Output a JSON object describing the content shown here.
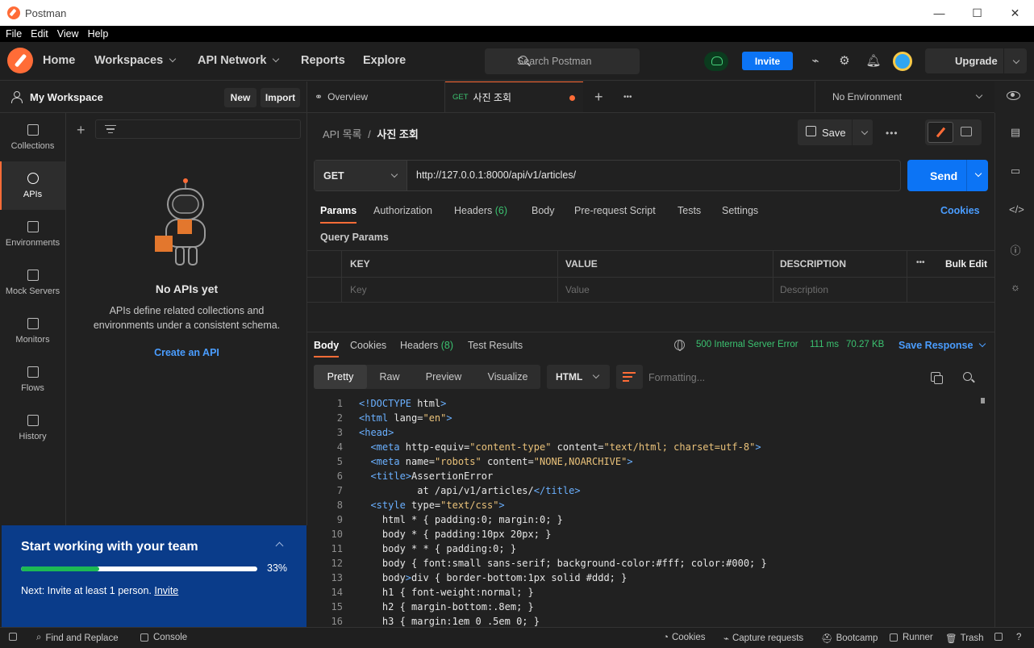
{
  "window": {
    "title": "Postman",
    "minimize_glyph": "—",
    "maximize_glyph": "☐",
    "close_glyph": "✕"
  },
  "menu": [
    "File",
    "Edit",
    "View",
    "Help"
  ],
  "nav": {
    "home": "Home",
    "workspaces": "Workspaces",
    "api_network": "API Network",
    "reports": "Reports",
    "explore": "Explore",
    "search_placeholder": "Search Postman",
    "invite": "Invite",
    "upgrade": "Upgrade"
  },
  "workspace": {
    "title": "My Workspace",
    "new_label": "New",
    "import_label": "Import"
  },
  "rail": [
    {
      "label": "Collections",
      "icon": "collections-icon"
    },
    {
      "label": "APIs",
      "icon": "apis-icon"
    },
    {
      "label": "Environments",
      "icon": "environments-icon"
    },
    {
      "label": "Mock Servers",
      "icon": "mock-servers-icon"
    },
    {
      "label": "Monitors",
      "icon": "monitors-icon"
    },
    {
      "label": "Flows",
      "icon": "flows-icon"
    },
    {
      "label": "History",
      "icon": "history-icon"
    }
  ],
  "rail_active": "APIs",
  "empty": {
    "title": "No APIs yet",
    "desc_line1": "APIs define related collections and",
    "desc_line2": "environments under a consistent schema.",
    "link": "Create an API"
  },
  "team": {
    "title": "Start working with your team",
    "progress": 0.33,
    "percent": "33%",
    "next": "Next: Invite at least 1 person.",
    "next_link": "Invite"
  },
  "tabs": {
    "overview": "Overview",
    "active_method": "GET",
    "active_name": "사진 조회",
    "add": "+",
    "more": "•••",
    "environment": "No Environment"
  },
  "request": {
    "breadcrumb_parent": "API 목록",
    "breadcrumb_sep": "/",
    "breadcrumb_current": "사진 조회",
    "save": "Save",
    "method": "GET",
    "url": "http://127.0.0.1:8000/api/v1/articles/",
    "send": "Send",
    "tabs": [
      "Params",
      "Authorization",
      "Headers",
      "Body",
      "Pre-request Script",
      "Tests",
      "Settings"
    ],
    "headers_count": "(6)",
    "cookies": "Cookies",
    "query_params": "Query Params",
    "columns": [
      "KEY",
      "VALUE",
      "DESCRIPTION"
    ],
    "bulk_edit": "Bulk Edit",
    "placeholders": [
      "Key",
      "Value",
      "Description"
    ]
  },
  "response": {
    "tabs": [
      "Body",
      "Cookies",
      "Headers",
      "Test Results"
    ],
    "headers_count": "(8)",
    "status": "500 Internal Server Error",
    "time": "111 ms",
    "size": "70.27 KB",
    "save_response": "Save Response",
    "views": [
      "Pretty",
      "Raw",
      "Preview",
      "Visualize"
    ],
    "format": "HTML",
    "formatting": "Formatting..."
  },
  "code_lines": [
    "<!DOCTYPE html>",
    "<html lang=\"en\">",
    "<head>",
    "  <meta http-equiv=\"content-type\" content=\"text/html; charset=utf-8\">",
    "  <meta name=\"robots\" content=\"NONE,NOARCHIVE\">",
    "  <title>AssertionError",
    "          at /api/v1/articles/</title>",
    "  <style type=\"text/css\">",
    "    html * { padding:0; margin:0; }",
    "    body * { padding:10px 20px; }",
    "    body * * { padding:0; }",
    "    body { font:small sans-serif; background-color:#fff; color:#000; }",
    "    body>div { border-bottom:1px solid #ddd; }",
    "    h1 { font-weight:normal; }",
    "    h2 { margin-bottom:.8em; }",
    "    h3 { margin:1em 0 .5em 0; }"
  ],
  "statusbar": {
    "find_replace": "Find and Replace",
    "console": "Console",
    "cookies": "Cookies",
    "capture": "Capture requests",
    "bootcamp": "Bootcamp",
    "runner": "Runner",
    "trash": "Trash"
  },
  "colors": {
    "accent": "#ff6c37",
    "primary": "#0c74f5",
    "success": "#3bc270",
    "team_bg": "#0a3c8a"
  }
}
